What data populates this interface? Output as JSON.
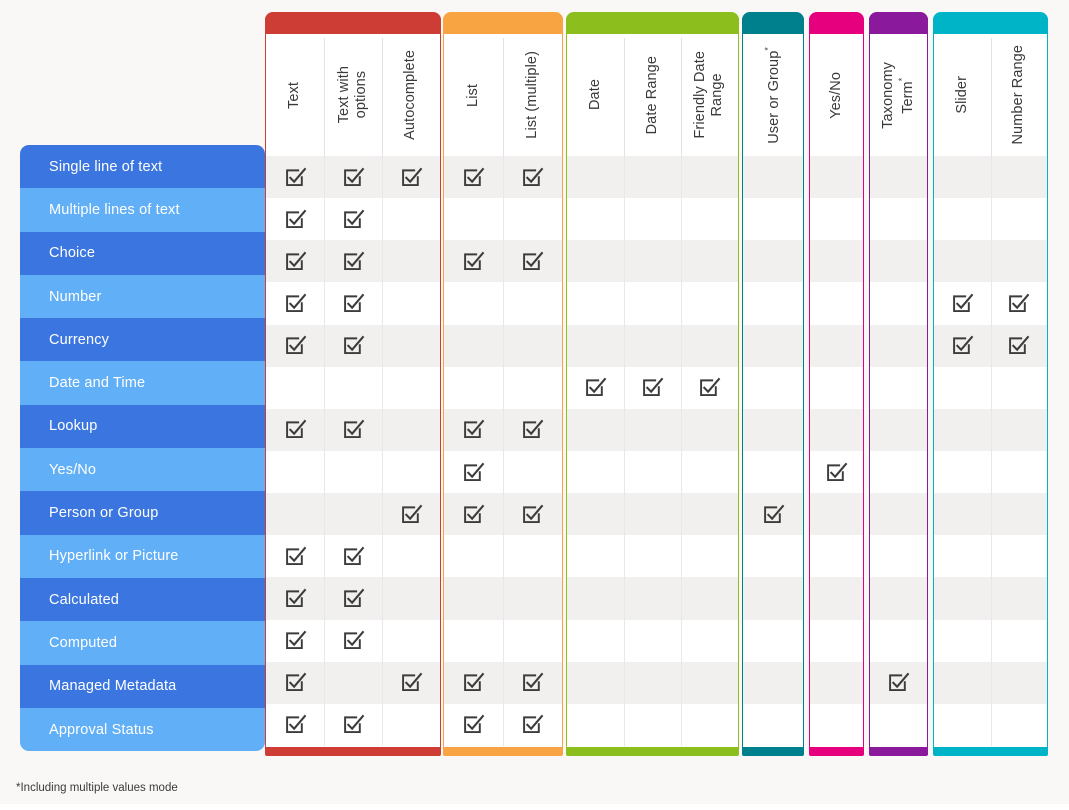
{
  "footnote": "*Including multiple values mode",
  "colors": {
    "page_background": "#f9f8f6",
    "row_label_dark": "#3b76e0",
    "row_label_light": "#61aff7",
    "cell_stripe": "#f1f0ee",
    "cell_plain": "#ffffff",
    "checkbox": "#3c3c3c"
  },
  "column_groups": [
    {
      "name": "text-group",
      "color": "#ce3c36",
      "columns": [
        "Text",
        "Text with\noptions",
        "Autocomplete"
      ]
    },
    {
      "name": "list-group",
      "color": "#f8a443",
      "columns": [
        "List",
        "List (multiple)"
      ]
    },
    {
      "name": "date-group",
      "color": "#8cbe1e",
      "columns": [
        "Date",
        "Date Range",
        "Friendly Date\nRange"
      ]
    },
    {
      "name": "user-group",
      "color": "#00808c",
      "columns": [
        "User or Group*"
      ]
    },
    {
      "name": "yesno-group",
      "color": "#e6007e",
      "columns": [
        "Yes/No"
      ]
    },
    {
      "name": "taxonomy-group",
      "color": "#8a1a9b",
      "columns": [
        "Taxonomy\nTerm*"
      ]
    },
    {
      "name": "numeric-group",
      "color": "#00b4c8",
      "columns": [
        "Slider",
        "Number Range"
      ]
    }
  ],
  "columns": [
    "Text",
    "Text with options",
    "Autocomplete",
    "List",
    "List (multiple)",
    "Date",
    "Date Range",
    "Friendly Date Range",
    "User or Group*",
    "Yes/No",
    "Taxonomy Term*",
    "Slider",
    "Number Range"
  ],
  "rows": [
    {
      "label": "Single line of text",
      "checks": [
        1,
        1,
        1,
        1,
        1,
        0,
        0,
        0,
        0,
        0,
        0,
        0,
        0
      ]
    },
    {
      "label": "Multiple lines of text",
      "checks": [
        1,
        1,
        0,
        0,
        0,
        0,
        0,
        0,
        0,
        0,
        0,
        0,
        0
      ]
    },
    {
      "label": "Choice",
      "checks": [
        1,
        1,
        0,
        1,
        1,
        0,
        0,
        0,
        0,
        0,
        0,
        0,
        0
      ]
    },
    {
      "label": "Number",
      "checks": [
        1,
        1,
        0,
        0,
        0,
        0,
        0,
        0,
        0,
        0,
        0,
        1,
        1
      ]
    },
    {
      "label": "Currency",
      "checks": [
        1,
        1,
        0,
        0,
        0,
        0,
        0,
        0,
        0,
        0,
        0,
        1,
        1
      ]
    },
    {
      "label": "Date and Time",
      "checks": [
        0,
        0,
        0,
        0,
        0,
        1,
        1,
        1,
        0,
        0,
        0,
        0,
        0
      ]
    },
    {
      "label": "Lookup",
      "checks": [
        1,
        1,
        0,
        1,
        1,
        0,
        0,
        0,
        0,
        0,
        0,
        0,
        0
      ]
    },
    {
      "label": "Yes/No",
      "checks": [
        0,
        0,
        0,
        1,
        0,
        0,
        0,
        0,
        0,
        1,
        0,
        0,
        0
      ]
    },
    {
      "label": "Person or Group",
      "checks": [
        0,
        0,
        1,
        1,
        1,
        0,
        0,
        0,
        1,
        0,
        0,
        0,
        0
      ]
    },
    {
      "label": "Hyperlink or Picture",
      "checks": [
        1,
        1,
        0,
        0,
        0,
        0,
        0,
        0,
        0,
        0,
        0,
        0,
        0
      ]
    },
    {
      "label": "Calculated",
      "checks": [
        1,
        1,
        0,
        0,
        0,
        0,
        0,
        0,
        0,
        0,
        0,
        0,
        0
      ]
    },
    {
      "label": "Computed",
      "checks": [
        1,
        1,
        0,
        0,
        0,
        0,
        0,
        0,
        0,
        0,
        0,
        0,
        0
      ]
    },
    {
      "label": "Managed Metadata",
      "checks": [
        1,
        0,
        1,
        1,
        1,
        0,
        0,
        0,
        0,
        0,
        1,
        0,
        0
      ]
    },
    {
      "label": "Approval Status",
      "checks": [
        1,
        1,
        0,
        1,
        1,
        0,
        0,
        0,
        0,
        0,
        0,
        0,
        0
      ]
    }
  ],
  "icons": {
    "checkbox": "checkbox-checked-icon"
  }
}
